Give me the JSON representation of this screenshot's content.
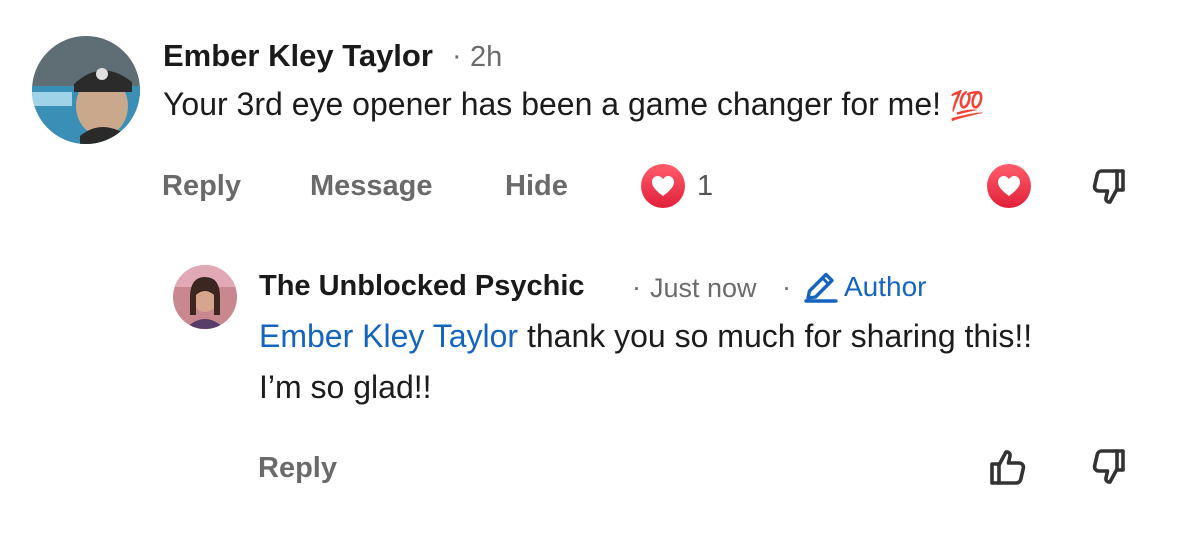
{
  "colors": {
    "mention": "#1565c0",
    "heart": "#ef3b4a",
    "meta": "#6b6b6b",
    "action": "#6a6a6a"
  },
  "comment": {
    "author": "Ember Kley Taylor",
    "separator": "·",
    "time": "2h",
    "text": "Your 3rd eye opener has been a game changer for me!",
    "emoji": "💯",
    "actions": {
      "reply": "Reply",
      "message": "Message",
      "hide": "Hide"
    },
    "reaction_count": "1",
    "icons": [
      "heart-reaction-icon",
      "heart-like-icon",
      "thumbs-down-icon"
    ]
  },
  "reply": {
    "author": "The Unblocked Psychic",
    "separator": "·",
    "time": "Just now",
    "separator2": "·",
    "badge": "Author",
    "mention": "Ember Kley Taylor",
    "text_line1": " thank you so much for sharing this!!",
    "text_line2": "I’m so glad!!",
    "actions": {
      "reply": "Reply"
    },
    "icons": [
      "pencil-icon",
      "thumbs-up-icon",
      "thumbs-down-icon"
    ]
  }
}
